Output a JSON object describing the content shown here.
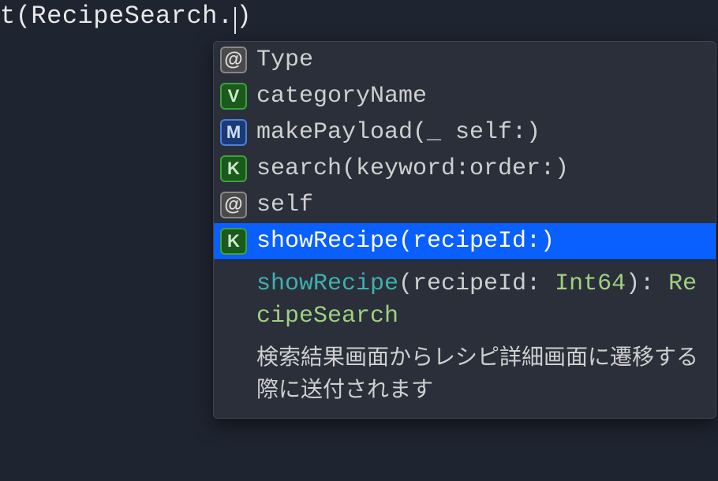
{
  "editor": {
    "before_caret": "t(RecipeSearch.",
    "after_caret": ")"
  },
  "completion": {
    "items": [
      {
        "kind": "@",
        "kind_class": "kind-at",
        "label": "Type"
      },
      {
        "kind": "V",
        "kind_class": "kind-v",
        "label": "categoryName"
      },
      {
        "kind": "M",
        "kind_class": "kind-m",
        "label": "makePayload(_ self:)"
      },
      {
        "kind": "K",
        "kind_class": "kind-k",
        "label": "search(keyword:order:)"
      },
      {
        "kind": "@",
        "kind_class": "kind-at",
        "label": "self"
      },
      {
        "kind": "K",
        "kind_class": "kind-k",
        "label": "showRecipe(recipeId:)",
        "selected": true
      }
    ],
    "detail": {
      "sig_func": "showRecipe",
      "sig_param_name": "recipeId",
      "sig_param_type": "Int64",
      "sig_return": "RecipeSearch",
      "doc": "検索結果画面からレシピ詳細画面に遷移する際に送付されます"
    }
  }
}
